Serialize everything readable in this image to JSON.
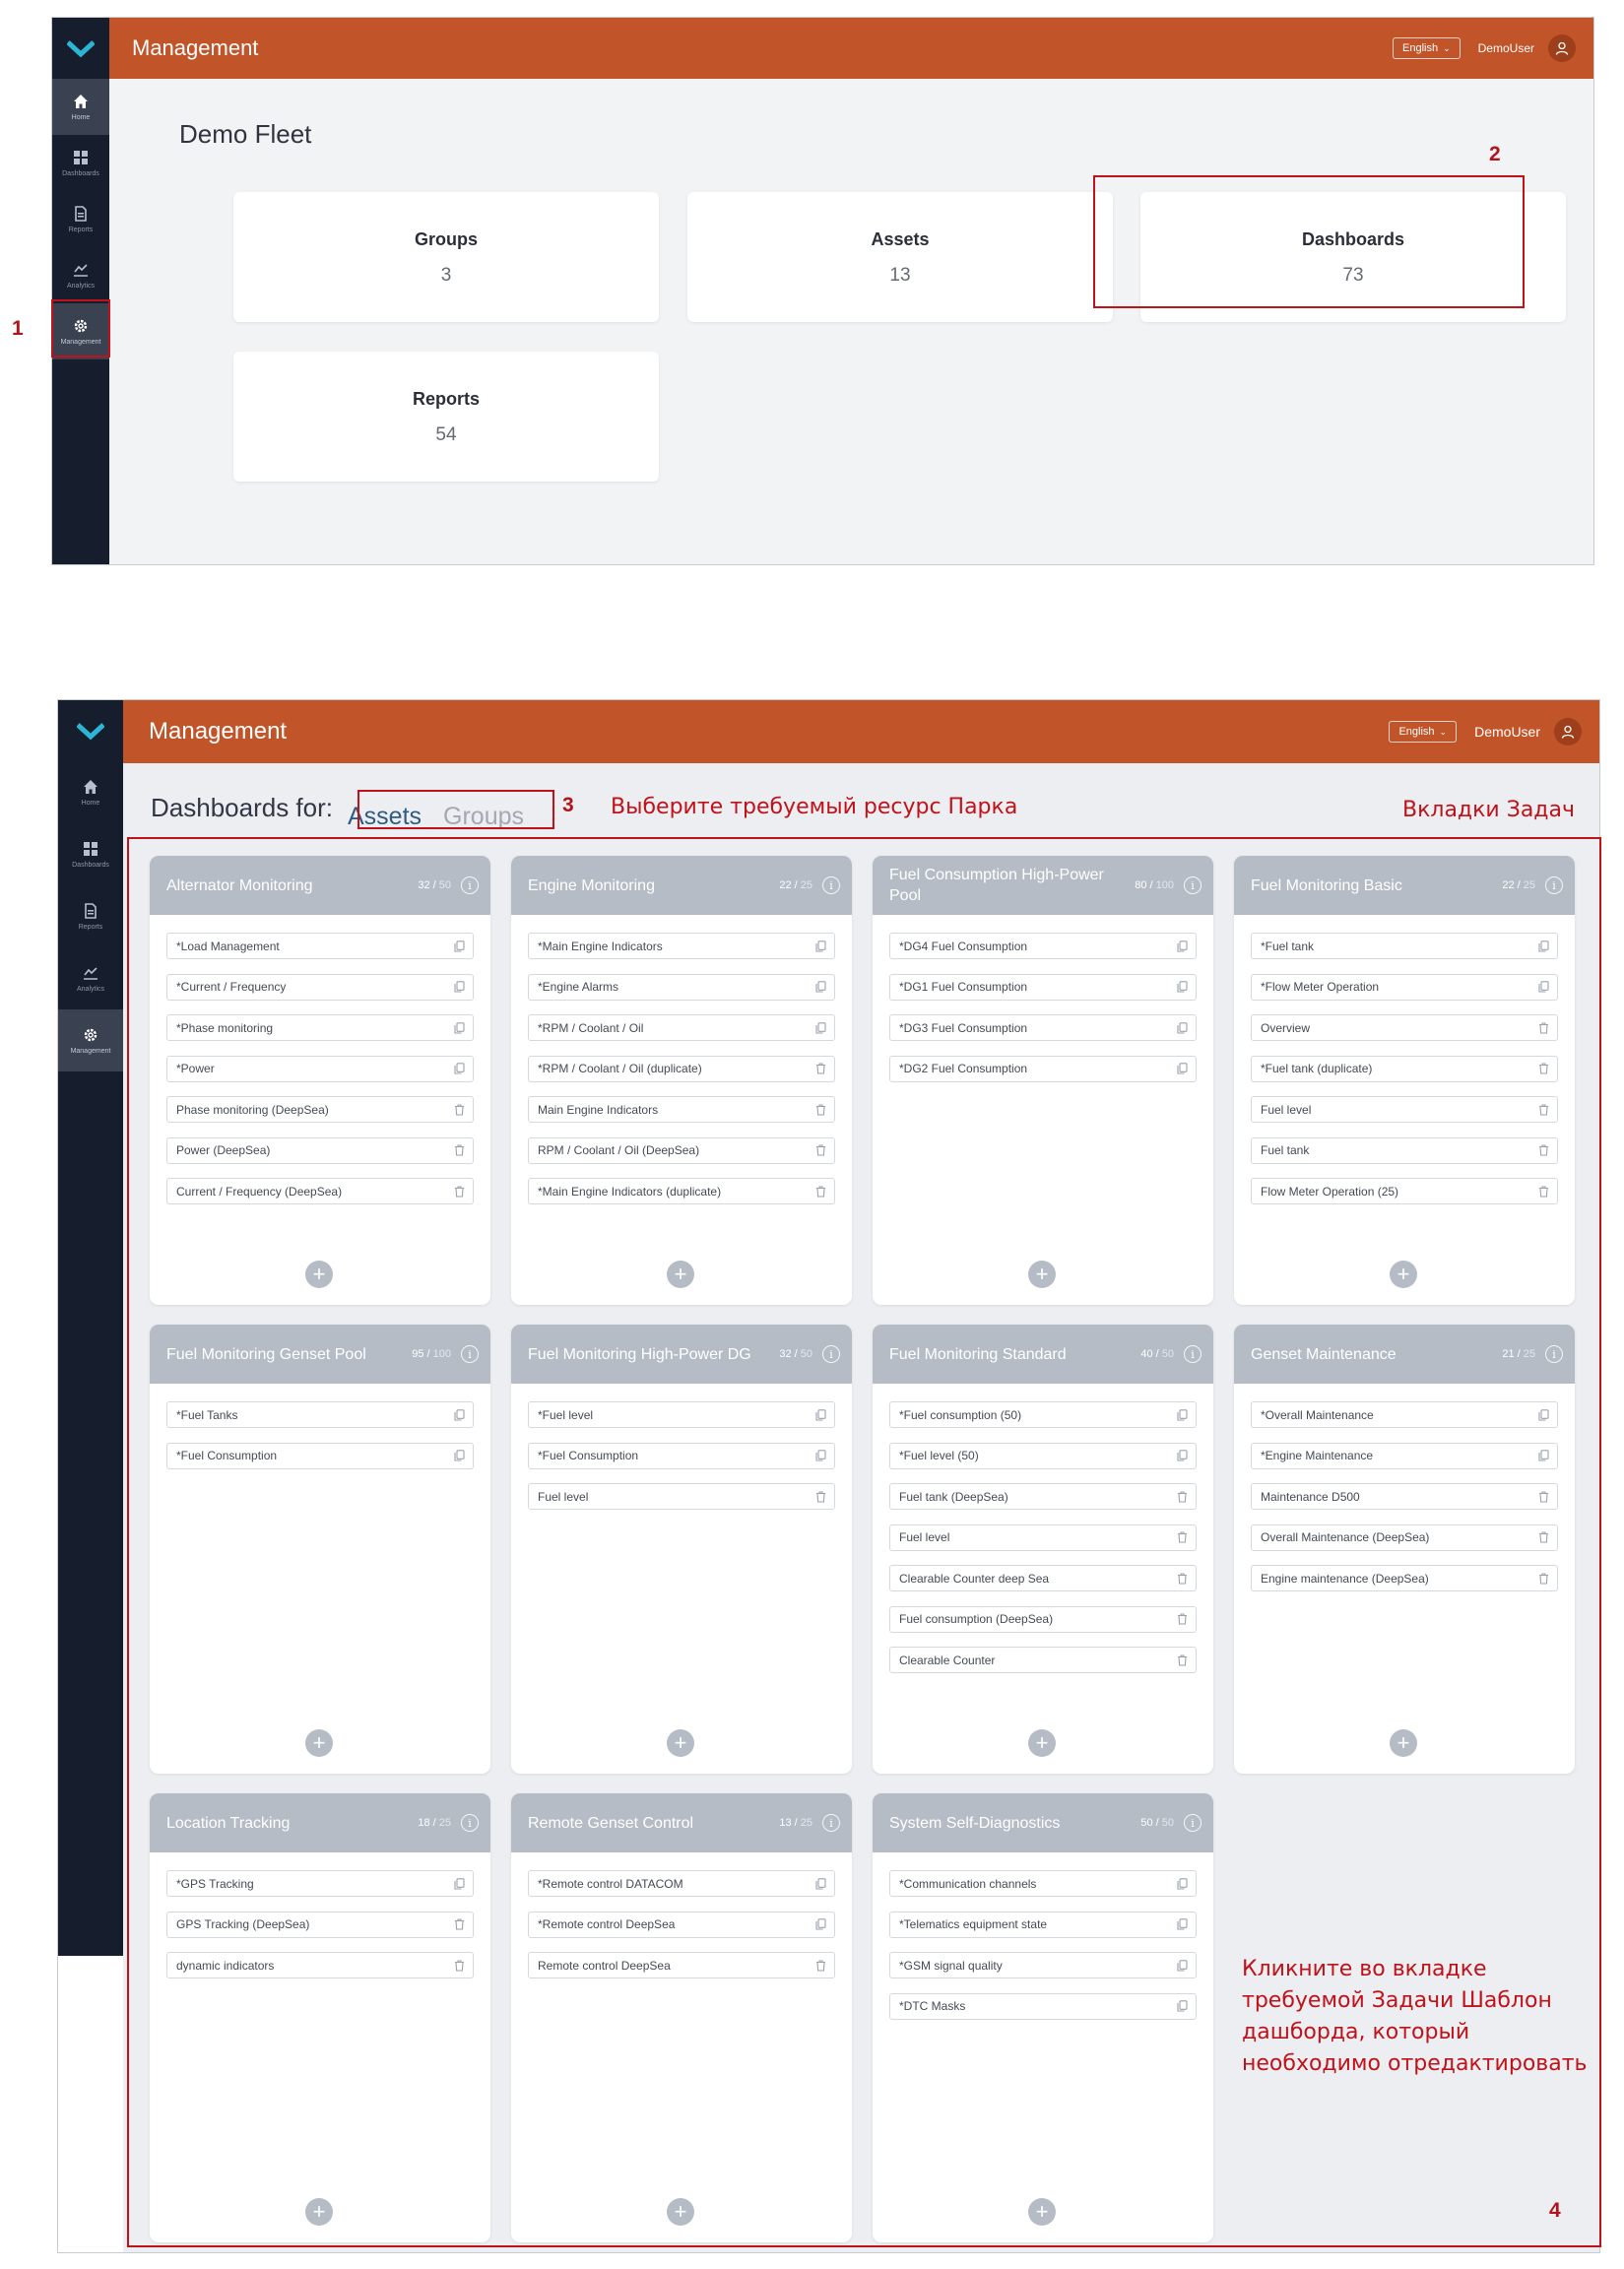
{
  "screen1": {
    "app_title": "Management",
    "language": "English",
    "user": "DemoUser",
    "nav": [
      {
        "label": "Home",
        "icon": "home-icon"
      },
      {
        "label": "Dashboards",
        "icon": "dashboards-icon"
      },
      {
        "label": "Reports",
        "icon": "reports-icon"
      },
      {
        "label": "Analytics",
        "icon": "analytics-icon"
      },
      {
        "label": "Management",
        "icon": "gear-icon"
      }
    ],
    "fleet_title": "Demo Fleet",
    "cards": [
      {
        "label": "Groups",
        "value": "3"
      },
      {
        "label": "Assets",
        "value": "13"
      },
      {
        "label": "Dashboards",
        "value": "73"
      },
      {
        "label": "Reports",
        "value": "54"
      }
    ]
  },
  "screen2": {
    "app_title": "Management",
    "language": "English",
    "user": "DemoUser",
    "nav": [
      {
        "label": "Home"
      },
      {
        "label": "Dashboards"
      },
      {
        "label": "Reports"
      },
      {
        "label": "Analytics"
      },
      {
        "label": "Management"
      }
    ],
    "heading": "Dashboards for:",
    "tab_assets": "Assets",
    "tab_groups": "Groups",
    "tasks": [
      {
        "title": "Alternator Monitoring",
        "count": "32",
        "max": "50",
        "templates": [
          {
            "name": "*Load Management",
            "icon": "copy-icon"
          },
          {
            "name": "*Current / Frequency",
            "icon": "copy-icon"
          },
          {
            "name": "*Phase monitoring",
            "icon": "copy-icon"
          },
          {
            "name": "*Power",
            "icon": "copy-icon"
          },
          {
            "name": "Phase monitoring (DeepSea)",
            "icon": "trash-icon"
          },
          {
            "name": "Power (DeepSea)",
            "icon": "trash-icon"
          },
          {
            "name": "Current / Frequency (DeepSea)",
            "icon": "trash-icon"
          }
        ]
      },
      {
        "title": "Engine Monitoring",
        "count": "22",
        "max": "25",
        "templates": [
          {
            "name": "*Main Engine Indicators",
            "icon": "copy-icon"
          },
          {
            "name": "*Engine Alarms",
            "icon": "copy-icon"
          },
          {
            "name": "*RPM / Coolant / Oil",
            "icon": "copy-icon"
          },
          {
            "name": "*RPM / Coolant / Oil (duplicate)",
            "icon": "trash-icon"
          },
          {
            "name": "Main Engine Indicators",
            "icon": "trash-icon"
          },
          {
            "name": "RPM / Coolant / Oil (DeepSea)",
            "icon": "trash-icon"
          },
          {
            "name": "*Main Engine Indicators (duplicate)",
            "icon": "trash-icon"
          }
        ]
      },
      {
        "title": "Fuel Consumption High-Power Pool",
        "count": "80",
        "max": "100",
        "templates": [
          {
            "name": "*DG4 Fuel Consumption",
            "icon": "copy-icon"
          },
          {
            "name": "*DG1 Fuel Consumption",
            "icon": "copy-icon"
          },
          {
            "name": "*DG3 Fuel Consumption",
            "icon": "copy-icon"
          },
          {
            "name": "*DG2 Fuel Consumption",
            "icon": "copy-icon"
          }
        ]
      },
      {
        "title": "Fuel Monitoring Basic",
        "count": "22",
        "max": "25",
        "templates": [
          {
            "name": "*Fuel tank",
            "icon": "copy-icon"
          },
          {
            "name": "*Flow Meter Operation",
            "icon": "copy-icon"
          },
          {
            "name": "Overview",
            "icon": "trash-icon"
          },
          {
            "name": "*Fuel tank (duplicate)",
            "icon": "trash-icon"
          },
          {
            "name": "Fuel level",
            "icon": "trash-icon"
          },
          {
            "name": "Fuel tank",
            "icon": "trash-icon"
          },
          {
            "name": "Flow Meter Operation (25)",
            "icon": "trash-icon"
          }
        ]
      },
      {
        "title": "Fuel Monitoring Genset Pool",
        "count": "95",
        "max": "100",
        "templates": [
          {
            "name": "*Fuel Tanks",
            "icon": "copy-icon"
          },
          {
            "name": "*Fuel Consumption",
            "icon": "copy-icon"
          }
        ]
      },
      {
        "title": "Fuel Monitoring High-Power DG",
        "count": "32",
        "max": "50",
        "templates": [
          {
            "name": "*Fuel level",
            "icon": "copy-icon"
          },
          {
            "name": "*Fuel Consumption",
            "icon": "copy-icon"
          },
          {
            "name": "Fuel level",
            "icon": "trash-icon"
          }
        ]
      },
      {
        "title": "Fuel Monitoring Standard",
        "count": "40",
        "max": "50",
        "templates": [
          {
            "name": "*Fuel consumption (50)",
            "icon": "copy-icon"
          },
          {
            "name": "*Fuel level (50)",
            "icon": "copy-icon"
          },
          {
            "name": "Fuel tank (DeepSea)",
            "icon": "trash-icon"
          },
          {
            "name": "Fuel level",
            "icon": "trash-icon"
          },
          {
            "name": "Clearable Counter deep Sea",
            "icon": "trash-icon"
          },
          {
            "name": "Fuel consumption (DeepSea)",
            "icon": "trash-icon"
          },
          {
            "name": "Clearable Counter",
            "icon": "trash-icon"
          }
        ]
      },
      {
        "title": "Genset Maintenance",
        "count": "21",
        "max": "25",
        "templates": [
          {
            "name": "*Overall Maintenance",
            "icon": "copy-icon"
          },
          {
            "name": "*Engine Maintenance",
            "icon": "copy-icon"
          },
          {
            "name": "Maintenance D500",
            "icon": "trash-icon"
          },
          {
            "name": "Overall Maintenance (DeepSea)",
            "icon": "trash-icon"
          },
          {
            "name": "Engine maintenance (DeepSea)",
            "icon": "trash-icon"
          }
        ]
      },
      {
        "title": "Location Tracking",
        "count": "18",
        "max": "25",
        "templates": [
          {
            "name": "*GPS Tracking",
            "icon": "copy-icon"
          },
          {
            "name": "GPS Tracking (DeepSea)",
            "icon": "trash-icon"
          },
          {
            "name": "dynamic indicators",
            "icon": "trash-icon"
          }
        ]
      },
      {
        "title": "Remote Genset Control",
        "count": "13",
        "max": "25",
        "templates": [
          {
            "name": "*Remote control DATACOM",
            "icon": "copy-icon"
          },
          {
            "name": "*Remote control DeepSea",
            "icon": "copy-icon"
          },
          {
            "name": "Remote control DeepSea",
            "icon": "trash-icon"
          }
        ]
      },
      {
        "title": "System Self-Diagnostics",
        "count": "50",
        "max": "50",
        "templates": [
          {
            "name": "*Communication channels",
            "icon": "copy-icon"
          },
          {
            "name": "*Telematics equipment state",
            "icon": "copy-icon"
          },
          {
            "name": "*GSM signal quality",
            "icon": "copy-icon"
          },
          {
            "name": "*DTC Masks",
            "icon": "copy-icon"
          }
        ]
      }
    ]
  },
  "annotations": {
    "marker_1": "1",
    "marker_2": "2",
    "marker_3": "3",
    "marker_4": "4",
    "note_resource": "Выберите требуемый ресурс Парка",
    "note_tabs": "Вкладки Задач",
    "note_click_1": "Кликните во вкладке",
    "note_click_2": "требуемой Задачи Шаблон",
    "note_click_3": "дашборда, который",
    "note_click_4": "необходимо отредактировать",
    "color": "#c0121a"
  },
  "colors": {
    "topbar": "#c15428",
    "sidebar": "#161d2c",
    "task_header": "#b5bcc6",
    "logo_accent": "#2ab6d4",
    "assets_tab": "#2f5b82"
  }
}
